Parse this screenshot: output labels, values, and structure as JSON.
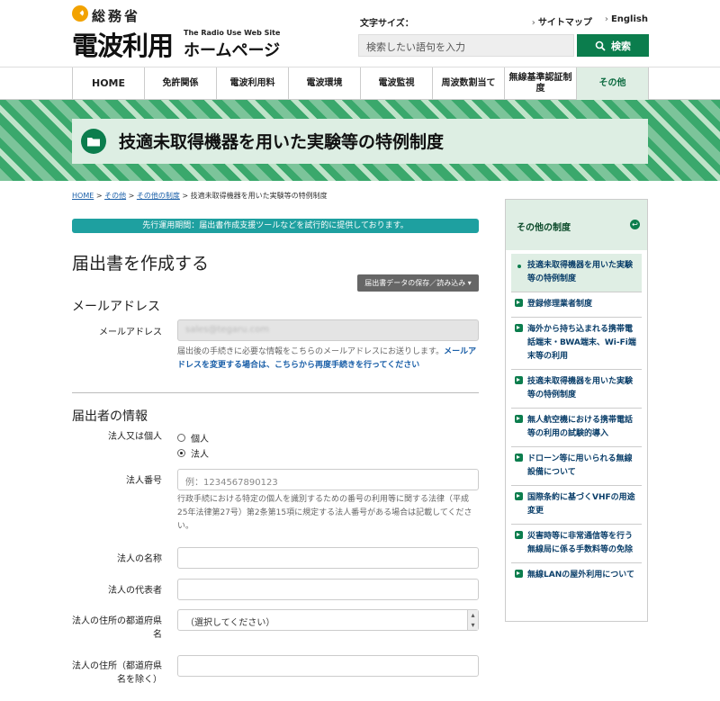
{
  "header": {
    "logo_small": "総務省",
    "logo_big": "電波利用",
    "logo_en": "The Radio Use Web Site",
    "logo_hp": "ホームページ",
    "font_size_label": "文字サイズ：",
    "sitemap": "サイトマップ",
    "english": "English",
    "search_placeholder": "検索したい語句を入力",
    "search_button": "検索"
  },
  "nav": {
    "items": [
      "HOME",
      "免許関係",
      "電波利用料",
      "電波環境",
      "電波監視",
      "周波数割当て",
      "無線基準認証制度",
      "その他"
    ]
  },
  "banner": {
    "title": "技適未取得機器を用いた実験等の特例制度"
  },
  "breadcrumb": {
    "home": "HOME",
    "sep": " > ",
    "l1": "その他",
    "l2": "その他の制度",
    "current": "技適未取得機器を用いた実験等の特例制度"
  },
  "notice": "先行運用期間：届出書作成支援ツールなどを試行的に提供しております。",
  "form": {
    "title": "届出書を作成する",
    "save_button": "届出書データの保存／読み込み",
    "email_section": "メールアドレス",
    "email_label": "メールアドレス",
    "email_value": "sales@tegaru.com",
    "email_help": "届出後の手続きに必要な情報をこちらのメールアドレスにお送りします。",
    "email_help_link": "メールアドレスを変更する場合は、こちらから再度手続きを行ってください",
    "applicant_section": "届出者の情報",
    "type_label": "法人又は個人",
    "type_options": [
      "個人",
      "法人"
    ],
    "corp_number_label": "法人番号",
    "corp_number_placeholder": "例：1234567890123",
    "corp_number_help": "行政手続における特定の個人を識別するための番号の利用等に関する法律（平成25年法律第27号）第2条第15項に規定する法人番号がある場合は記載してください。",
    "corp_name_label": "法人の名称",
    "rep_label": "法人の代表者",
    "pref_label": "法人の住所の都道府県名",
    "pref_value": "（選択してください）",
    "addr_label": "法人の住所（都道府県名を除く）"
  },
  "sidebar": {
    "title": "その他の制度",
    "items": [
      "技適未取得機器を用いた実験等の特例制度",
      "登録修理業者制度",
      "海外から持ち込まれる携帯電話端末・BWA端末、Wi-Fi端末等の利用",
      "技適未取得機器を用いた実験等の特例制度",
      "無人航空機における携帯電話等の利用の試験的導入",
      "ドローン等に用いられる無線設備について",
      "国際条約に基づくVHFの用途変更",
      "災害時等に非常通信等を行う無線局に係る手数料等の免除",
      "無線LANの屋外利用について"
    ]
  },
  "colors": {
    "brand_green": "#0b7d4d",
    "notice_teal": "#1ea0a0",
    "link_blue": "#1a5fa8"
  }
}
